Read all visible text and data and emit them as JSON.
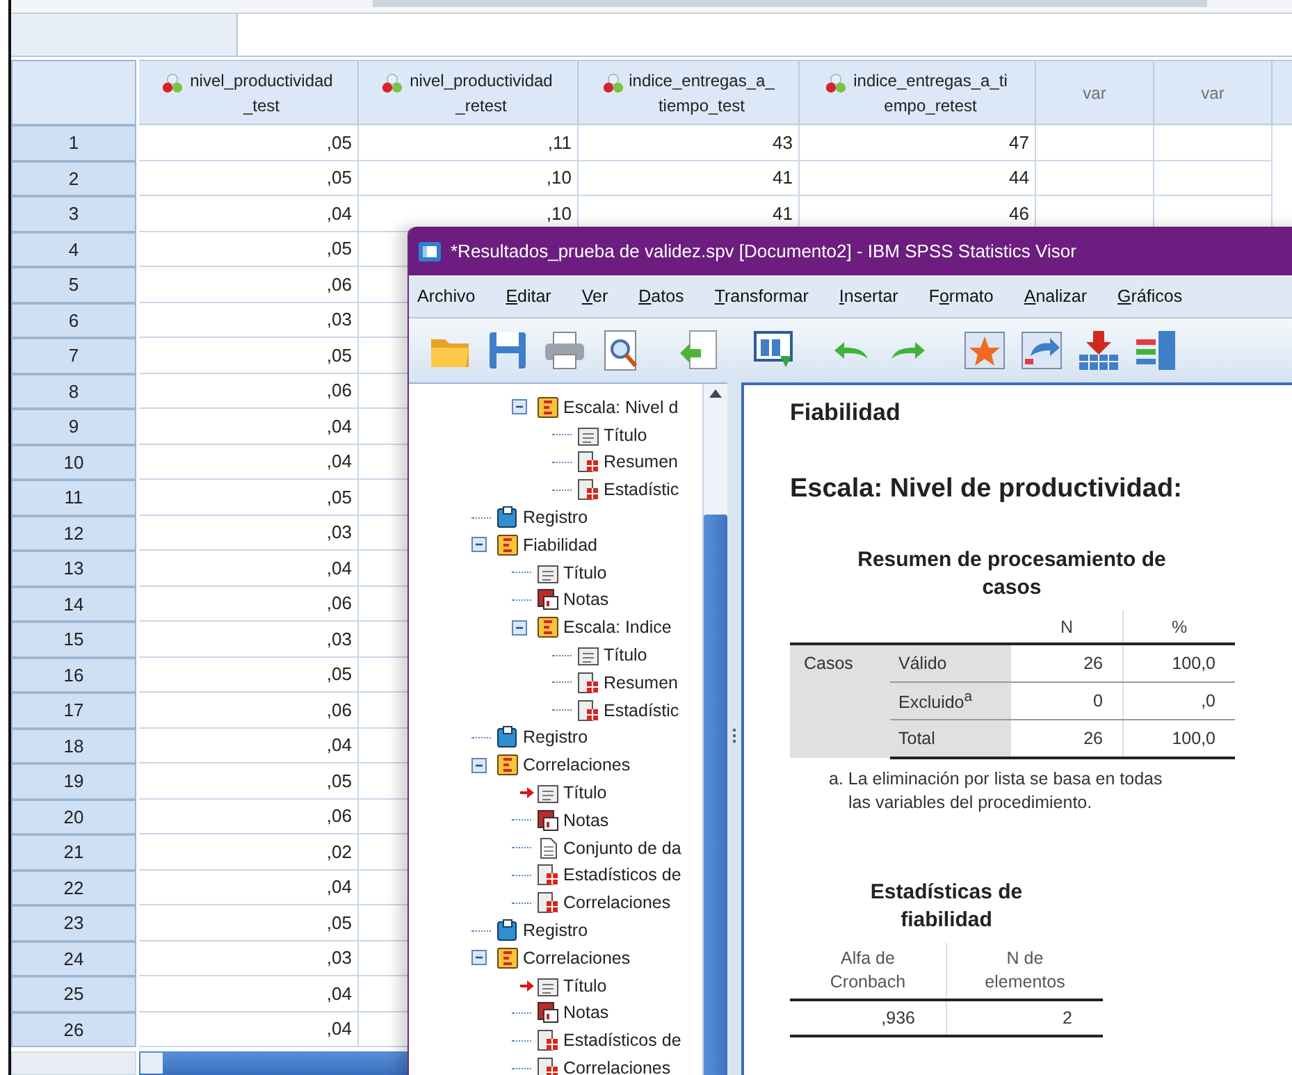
{
  "data_editor": {
    "columns": [
      {
        "label": "nivel_productividad_test",
        "kind": "scale"
      },
      {
        "label": "nivel_productividad_retest",
        "kind": "scale"
      },
      {
        "label": "indice_entregas_a_tiempo_test",
        "kind": "scale"
      },
      {
        "label": "indice_entregas_a_tiempo_retest",
        "kind": "scale"
      },
      {
        "label": "var",
        "kind": "empty"
      },
      {
        "label": "var",
        "kind": "empty"
      }
    ],
    "rows": [
      {
        "n": "1",
        "cells": [
          ",05",
          ",11",
          "43",
          "47"
        ]
      },
      {
        "n": "2",
        "cells": [
          ",05",
          ",10",
          "41",
          "44"
        ]
      },
      {
        "n": "3",
        "cells": [
          ",04",
          ",10",
          "41",
          "46"
        ]
      },
      {
        "n": "4",
        "cells": [
          ",05"
        ]
      },
      {
        "n": "5",
        "cells": [
          ",06"
        ]
      },
      {
        "n": "6",
        "cells": [
          ",03"
        ]
      },
      {
        "n": "7",
        "cells": [
          ",05"
        ]
      },
      {
        "n": "8",
        "cells": [
          ",06"
        ]
      },
      {
        "n": "9",
        "cells": [
          ",04"
        ]
      },
      {
        "n": "10",
        "cells": [
          ",04"
        ]
      },
      {
        "n": "11",
        "cells": [
          ",05"
        ]
      },
      {
        "n": "12",
        "cells": [
          ",03"
        ]
      },
      {
        "n": "13",
        "cells": [
          ",04"
        ]
      },
      {
        "n": "14",
        "cells": [
          ",06"
        ]
      },
      {
        "n": "15",
        "cells": [
          ",03"
        ]
      },
      {
        "n": "16",
        "cells": [
          ",05"
        ]
      },
      {
        "n": "17",
        "cells": [
          ",06"
        ]
      },
      {
        "n": "18",
        "cells": [
          ",04"
        ]
      },
      {
        "n": "19",
        "cells": [
          ",05"
        ]
      },
      {
        "n": "20",
        "cells": [
          ",06"
        ]
      },
      {
        "n": "21",
        "cells": [
          ",02"
        ]
      },
      {
        "n": "22",
        "cells": [
          ",04"
        ]
      },
      {
        "n": "23",
        "cells": [
          ",05"
        ]
      },
      {
        "n": "24",
        "cells": [
          ",03"
        ]
      },
      {
        "n": "25",
        "cells": [
          ",04"
        ]
      },
      {
        "n": "26",
        "cells": [
          ",04"
        ]
      }
    ]
  },
  "viewer": {
    "title": "*Resultados_prueba de validez.spv [Documento2] - IBM SPSS Statistics Visor",
    "menus": [
      {
        "pre": "Archivo"
      },
      {
        "key": "E",
        "post": "ditar"
      },
      {
        "key": "V",
        "post": "er"
      },
      {
        "key": "D",
        "post": "atos"
      },
      {
        "key": "T",
        "post": "ransformar"
      },
      {
        "key": "I",
        "post": "nsertar"
      },
      {
        "pre": "F",
        "key": "o",
        "post": "rmato"
      },
      {
        "key": "A",
        "post": "nalizar"
      },
      {
        "key": "G",
        "post": "ráficos"
      }
    ],
    "tree": {
      "continued": [
        {
          "label": "Escala: Nivel d",
          "kind": "heading",
          "expanded": true,
          "children": [
            {
              "label": "Título",
              "kind": "title",
              "current": false
            },
            {
              "label": "Resumen",
              "kind": "table"
            },
            {
              "label": "Estadístic",
              "kind": "table"
            }
          ]
        }
      ],
      "items": [
        {
          "label": "Registro",
          "kind": "log"
        },
        {
          "label": "Fiabilidad",
          "kind": "heading",
          "expanded": true,
          "children": [
            {
              "label": "Título",
              "kind": "title",
              "current": false
            },
            {
              "label": "Notas",
              "kind": "notes"
            },
            {
              "label": "Escala: Indice",
              "kind": "heading",
              "expanded": true,
              "children": [
                {
                  "label": "Título",
                  "kind": "title",
                  "current": false
                },
                {
                  "label": "Resumen",
                  "kind": "table"
                },
                {
                  "label": "Estadístic",
                  "kind": "table"
                }
              ]
            }
          ]
        },
        {
          "label": "Registro",
          "kind": "log"
        },
        {
          "label": "Correlaciones",
          "kind": "heading",
          "expanded": true,
          "children": [
            {
              "label": "Título",
              "kind": "title",
              "current": true
            },
            {
              "label": "Notas",
              "kind": "notes"
            },
            {
              "label": "Conjunto de da",
              "kind": "text"
            },
            {
              "label": "Estadísticos de",
              "kind": "table"
            },
            {
              "label": "Correlaciones",
              "kind": "table"
            }
          ]
        },
        {
          "label": "Registro",
          "kind": "log"
        },
        {
          "label": "Correlaciones",
          "kind": "heading",
          "expanded": true,
          "children": [
            {
              "label": "Título",
              "kind": "title",
              "current": true
            },
            {
              "label": "Notas",
              "kind": "notes"
            },
            {
              "label": "Estadísticos de",
              "kind": "table"
            },
            {
              "label": "Correlaciones",
              "kind": "table"
            }
          ]
        }
      ]
    },
    "output": {
      "heading": "Fiabilidad",
      "subheading": "Escala: Nivel de productividad:",
      "case_table": {
        "title": "Resumen de procesamiento de casos",
        "columns": [
          "N",
          "%"
        ],
        "group": "Casos",
        "rows": [
          {
            "label": "Válido",
            "n": "26",
            "pct": "100,0"
          },
          {
            "label": "Excluido$^{a}$",
            "n": "0",
            "pct": ",0"
          },
          {
            "label": "Total",
            "n": "26",
            "pct": "100,0"
          }
        ],
        "footnote": "a. La eliminación por lista se basa en todas las variables del procedimiento."
      },
      "reliability_table": {
        "title": "Estadísticas de fiabilidad",
        "columns": [
          "Alfa de Cronbach",
          "N de elementos"
        ],
        "row": [
          ",936",
          "2"
        ]
      }
    }
  }
}
